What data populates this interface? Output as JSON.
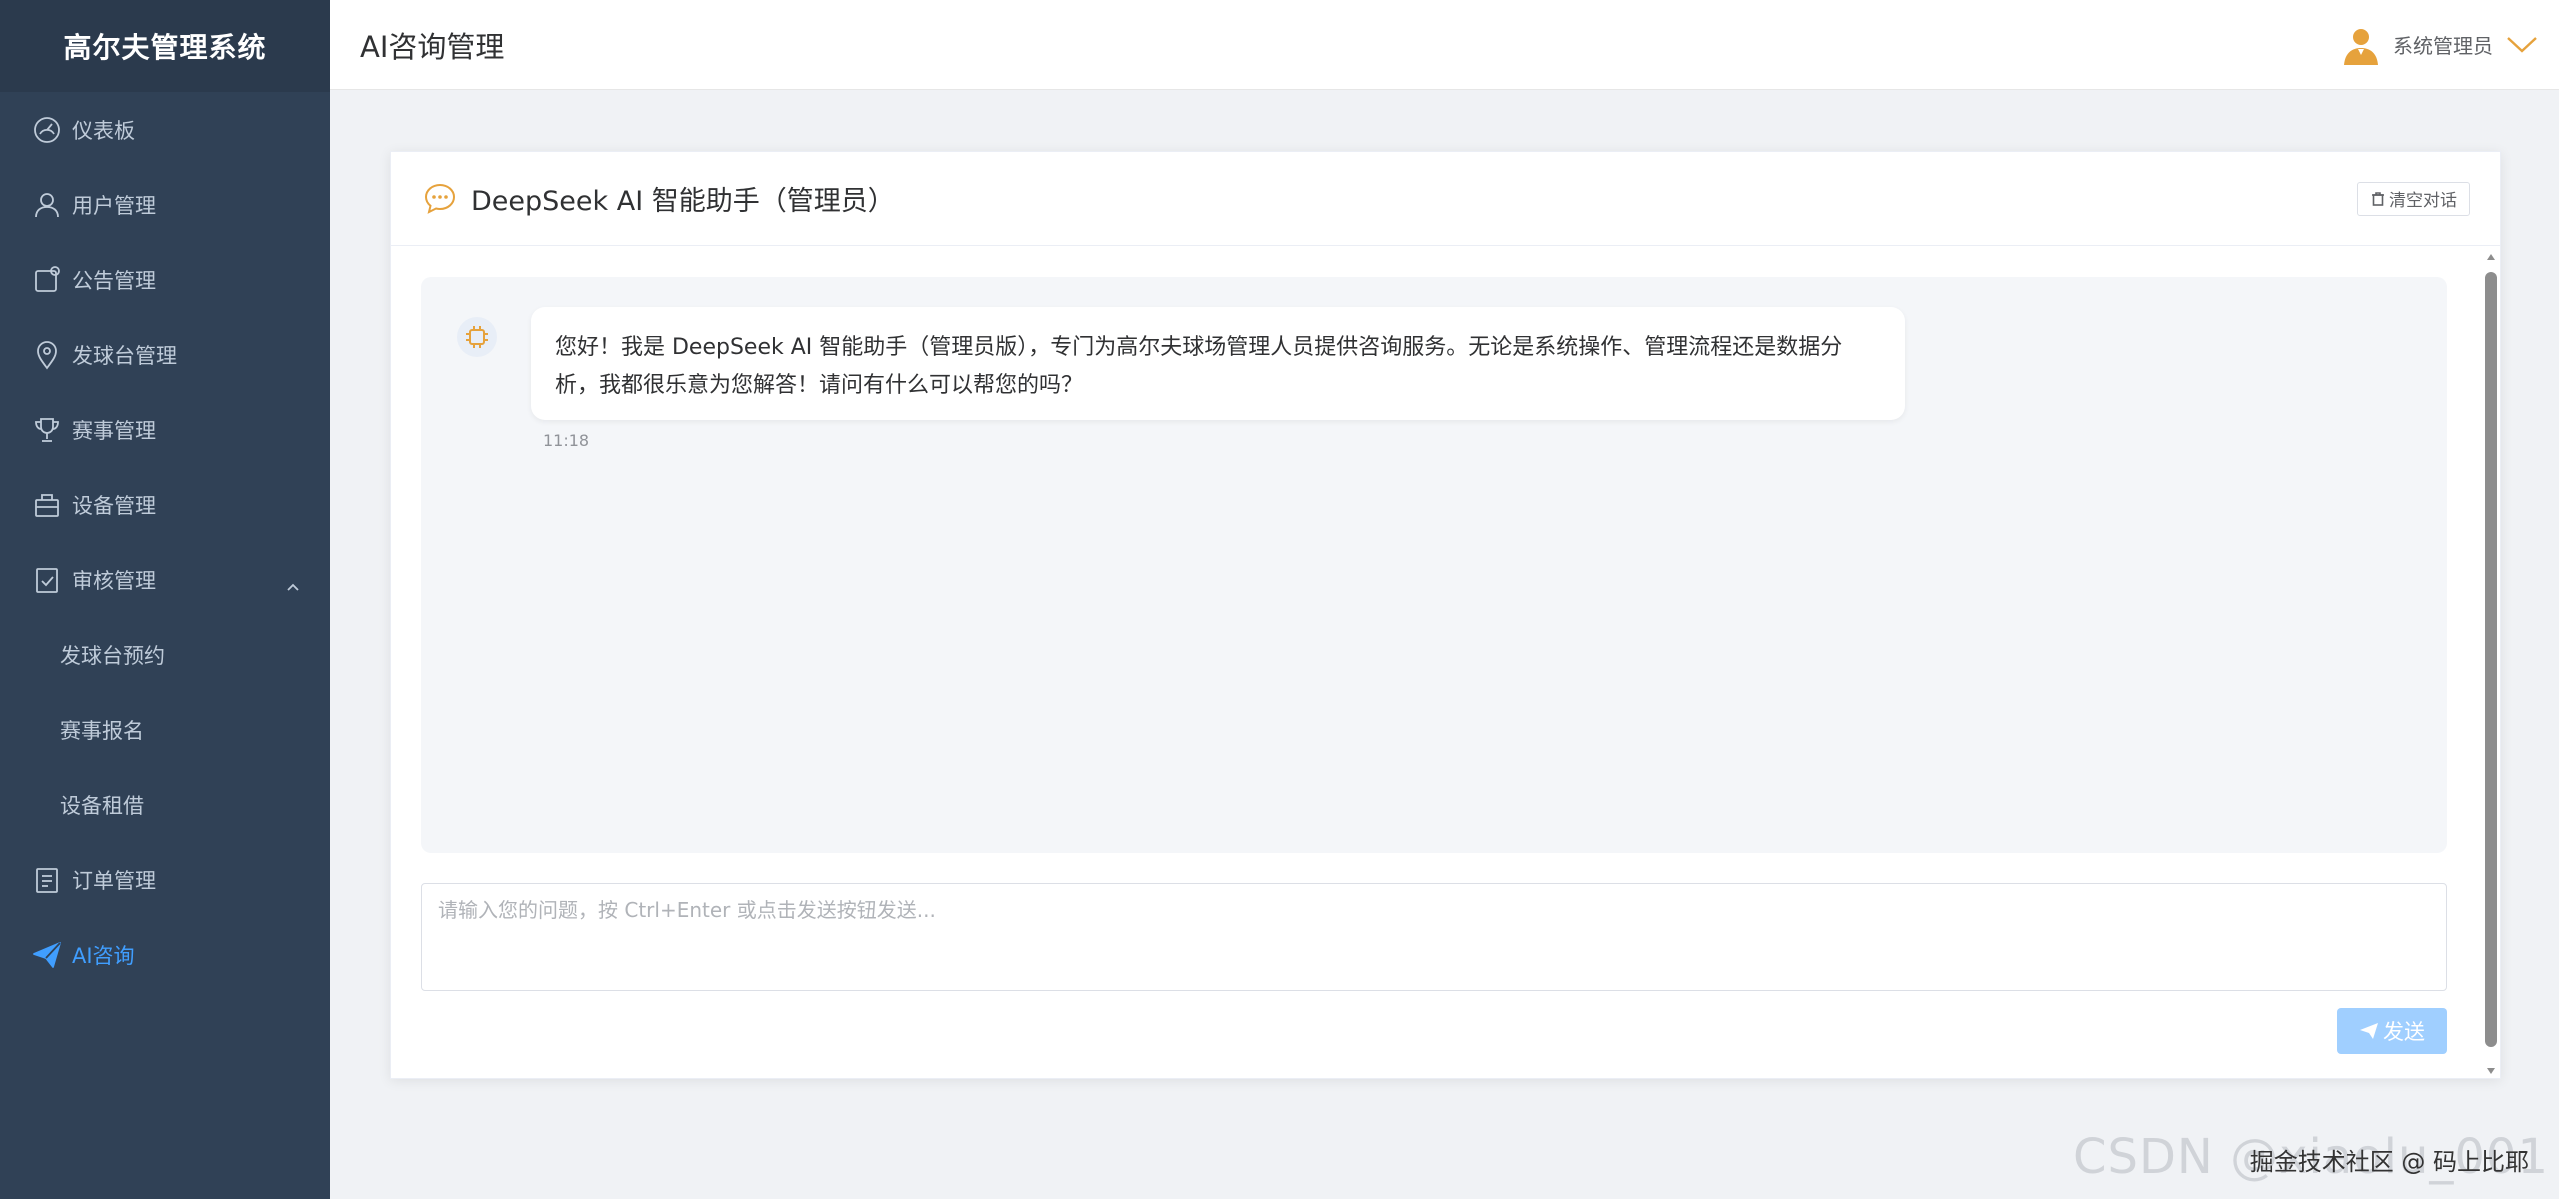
{
  "sidebar": {
    "brand": "高尔夫管理系统",
    "items": [
      {
        "label": "仪表板",
        "icon": "dashboard-icon"
      },
      {
        "label": "用户管理",
        "icon": "user-icon"
      },
      {
        "label": "公告管理",
        "icon": "notice-icon"
      },
      {
        "label": "发球台管理",
        "icon": "location-icon"
      },
      {
        "label": "赛事管理",
        "icon": "trophy-icon"
      },
      {
        "label": "设备管理",
        "icon": "briefcase-icon"
      },
      {
        "label": "审核管理",
        "icon": "document-check-icon"
      },
      {
        "label": "订单管理",
        "icon": "list-document-icon"
      },
      {
        "label": "AI咨询",
        "icon": "send-plane-icon"
      }
    ],
    "audit_sub": [
      "发球台预约",
      "赛事报名",
      "设备租借"
    ],
    "active": "AI咨询"
  },
  "header": {
    "title": "AI咨询管理",
    "username": "系统管理员"
  },
  "chat": {
    "title": "DeepSeek AI 智能助手（管理员）",
    "clear_label": "清空对话",
    "messages": [
      {
        "role": "assistant",
        "text": "您好！我是 DeepSeek AI 智能助手（管理员版），专门为高尔夫球场管理人员提供咨询服务。无论是系统操作、管理流程还是数据分析，我都很乐意为您解答！请问有什么可以帮您的吗？",
        "time": "11:18"
      }
    ],
    "input_placeholder": "请输入您的问题，按 Ctrl+Enter 或点击发送按钮发送...",
    "send_label": "发送"
  },
  "watermark": {
    "text": "CSDN @xiaolu_001",
    "overlay": "掘金技术社区 @ 码上比耶"
  },
  "colors": {
    "sidebar_bg": "#304156",
    "active": "#409eff",
    "send_disabled": "#a0cfff",
    "icon_orange": "#e6a23c"
  }
}
